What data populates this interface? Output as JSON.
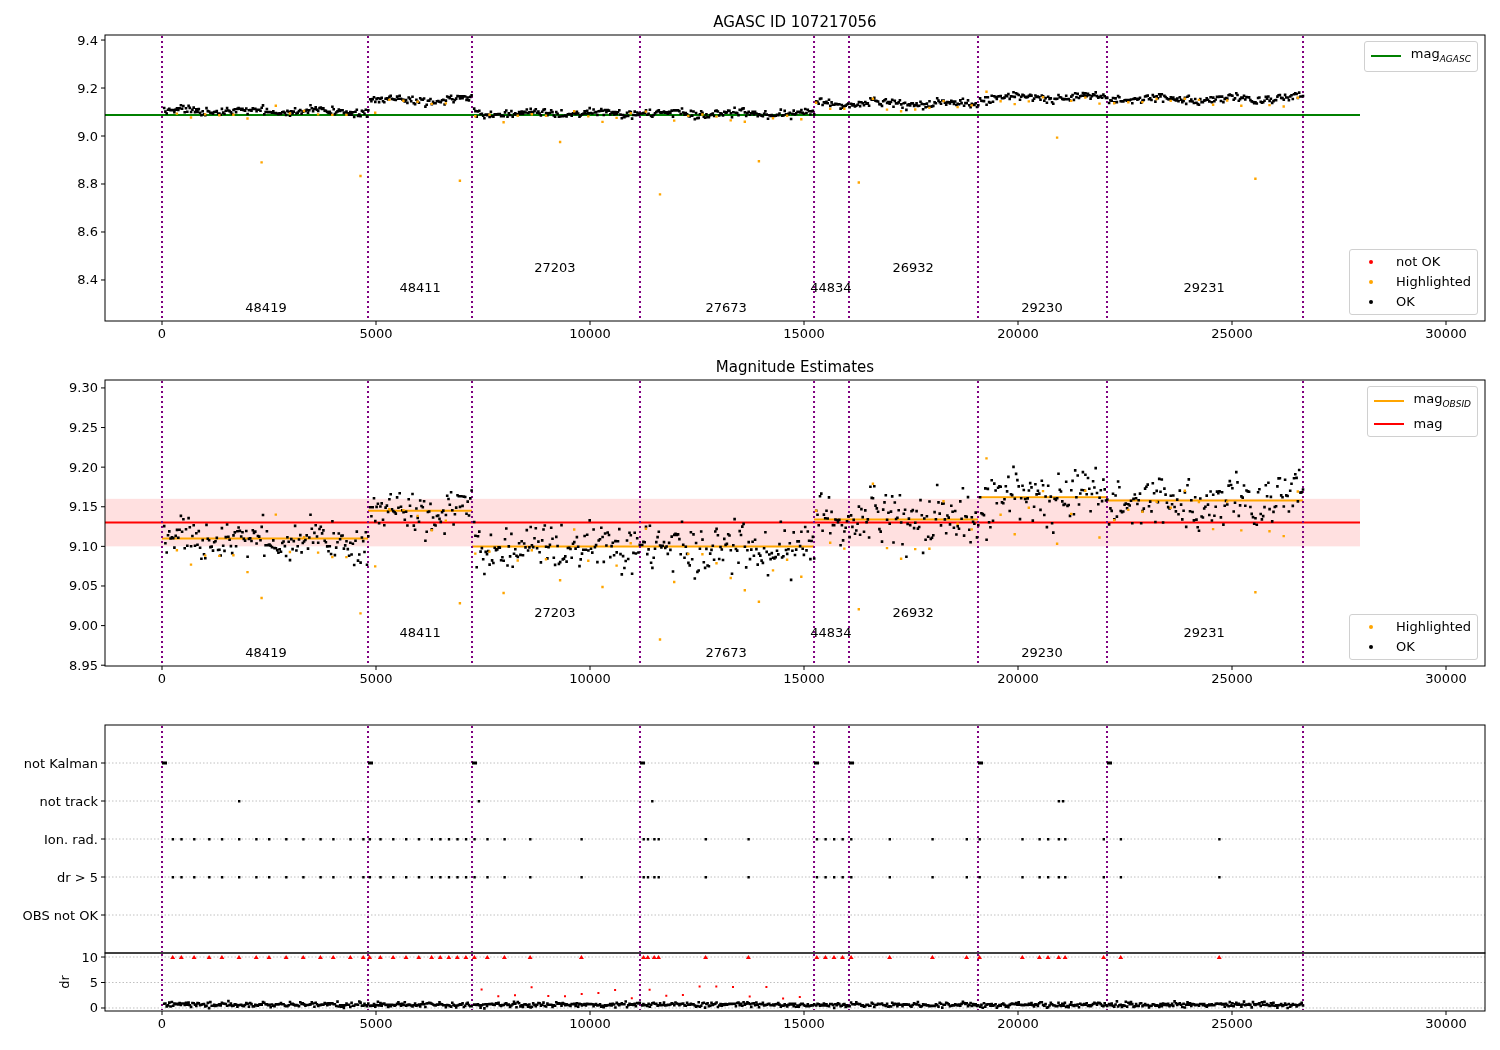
{
  "figure": {
    "panels": [
      {
        "kind": "agasc",
        "title": "AGASC ID 107217056",
        "marker_legend": [
          {
            "label": "not OK",
            "color": "#ff0000"
          },
          {
            "label": "Highlighted",
            "color": "#ffa500"
          },
          {
            "label": "OK",
            "color": "#000000"
          }
        ],
        "chart_data": {
          "type": "line",
          "xlim": [
            -1332,
            30911
          ],
          "ylim": [
            8.229,
            9.421
          ],
          "xticks": [
            0,
            5000,
            10000,
            15000,
            20000,
            25000,
            30000
          ],
          "yticks": [
            {
              "value": 8.4,
              "label": "8.4"
            },
            {
              "value": 8.6,
              "label": "8.6"
            },
            {
              "value": 8.8,
              "label": "8.8"
            },
            {
              "value": 9.0,
              "label": "9.0"
            },
            {
              "value": 9.2,
              "label": "9.2"
            },
            {
              "value": 9.4,
              "label": "9.4"
            }
          ],
          "series": [
            {
              "name": "mag$_{AGASC}$",
              "color": "#008000",
              "x": [
                -1332,
                27990
              ],
              "values": [
                9.088,
                9.088
              ]
            }
          ],
          "ref_lines": [
            {
              "axis": "x",
              "value": 0
            },
            {
              "axis": "x",
              "value": 4813
            },
            {
              "axis": "x",
              "value": 7243
            },
            {
              "axis": "x",
              "value": 11168
            },
            {
              "axis": "x",
              "value": 15234
            },
            {
              "axis": "x",
              "value": 16051
            },
            {
              "axis": "x",
              "value": 19065
            },
            {
              "axis": "x",
              "value": 22079
            },
            {
              "axis": "x",
              "value": 26659
            }
          ],
          "annotations": [
            "48419",
            "48411",
            "27203",
            "27673",
            "44834",
            "26932",
            "29230",
            "29231"
          ]
        }
      },
      {
        "kind": "estimates",
        "title": "Magnitude Estimates",
        "marker_legend": [
          {
            "label": "Highlighted",
            "color": "#ffa500"
          },
          {
            "label": "OK",
            "color": "#000000"
          }
        ],
        "chart_data": {
          "type": "line",
          "xlim": [
            -1332,
            30911
          ],
          "ylim": [
            8.949,
            9.31
          ],
          "xticks": [
            0,
            5000,
            10000,
            15000,
            20000,
            25000,
            30000
          ],
          "yticks": [
            {
              "value": 8.95,
              "label": "8.95"
            },
            {
              "value": 9.0,
              "label": "9.00"
            },
            {
              "value": 9.05,
              "label": "9.05"
            },
            {
              "value": 9.1,
              "label": "9.10"
            },
            {
              "value": 9.15,
              "label": "9.15"
            },
            {
              "value": 9.2,
              "label": "9.20"
            },
            {
              "value": 9.25,
              "label": "9.25"
            },
            {
              "value": 9.3,
              "label": "9.30"
            }
          ],
          "series": [
            {
              "name": "mag$_{OBSID}$",
              "color": "#ffa500",
              "x": [
                0,
                4813,
                4813,
                7243,
                7243,
                15234,
                15234,
                19065,
                19065,
                22079,
                22079,
                26659
              ],
              "values": [
                9.11,
                9.11,
                9.145,
                9.145,
                9.1,
                9.1,
                9.134,
                9.134,
                9.162,
                9.162,
                9.158,
                9.158
              ]
            },
            {
              "name": "mag",
              "color": "#ff0000",
              "x": [
                -1332,
                27990
              ],
              "values": [
                9.13,
                9.13
              ]
            }
          ],
          "bands": [
            {
              "axis": "y",
              "from": 9.1,
              "to": 9.16,
              "color": "#ffe0e0"
            }
          ],
          "ref_lines": [
            {
              "axis": "x",
              "value": 0
            },
            {
              "axis": "x",
              "value": 4813
            },
            {
              "axis": "x",
              "value": 7243
            },
            {
              "axis": "x",
              "value": 11168
            },
            {
              "axis": "x",
              "value": 15234
            },
            {
              "axis": "x",
              "value": 16051
            },
            {
              "axis": "x",
              "value": 19065
            },
            {
              "axis": "x",
              "value": 22079
            },
            {
              "axis": "x",
              "value": 26659
            }
          ],
          "annotations": [
            "48419",
            "48411",
            "27203",
            "27673",
            "44834",
            "26932",
            "29230",
            "29231"
          ]
        }
      },
      {
        "kind": "flags",
        "chart_data": {
          "type": "scatter",
          "orientation": "horizontal",
          "xlim": [
            -1332,
            30911
          ],
          "grid": true,
          "categories": [
            "not Kalman",
            "not track",
            "Ion. rad.",
            "dr > 5",
            "OBS not OK"
          ],
          "ref_lines": [
            {
              "axis": "x",
              "value": 0
            },
            {
              "axis": "x",
              "value": 4813
            },
            {
              "axis": "x",
              "value": 7243
            },
            {
              "axis": "x",
              "value": 11168
            },
            {
              "axis": "x",
              "value": 15234
            },
            {
              "axis": "x",
              "value": 16051
            },
            {
              "axis": "x",
              "value": 19065
            },
            {
              "axis": "x",
              "value": 22079
            },
            {
              "axis": "x",
              "value": 26659
            }
          ]
        }
      },
      {
        "kind": "dr",
        "chart_data": {
          "type": "scatter",
          "ylabel": "dr",
          "xlim": [
            -1332,
            30911
          ],
          "ylim": [
            -0.59,
            10.79
          ],
          "grid": true,
          "xticks": [
            0,
            5000,
            10000,
            15000,
            20000,
            25000,
            30000
          ],
          "yticks": [
            0,
            5,
            10
          ],
          "ref_lines": [
            {
              "axis": "x",
              "value": 0
            },
            {
              "axis": "x",
              "value": 4813
            },
            {
              "axis": "x",
              "value": 7243
            },
            {
              "axis": "x",
              "value": 11168
            },
            {
              "axis": "x",
              "value": 15234
            },
            {
              "axis": "x",
              "value": 16051
            },
            {
              "axis": "x",
              "value": 19065
            },
            {
              "axis": "x",
              "value": 22079
            },
            {
              "axis": "x",
              "value": 26659
            }
          ]
        }
      }
    ]
  }
}
